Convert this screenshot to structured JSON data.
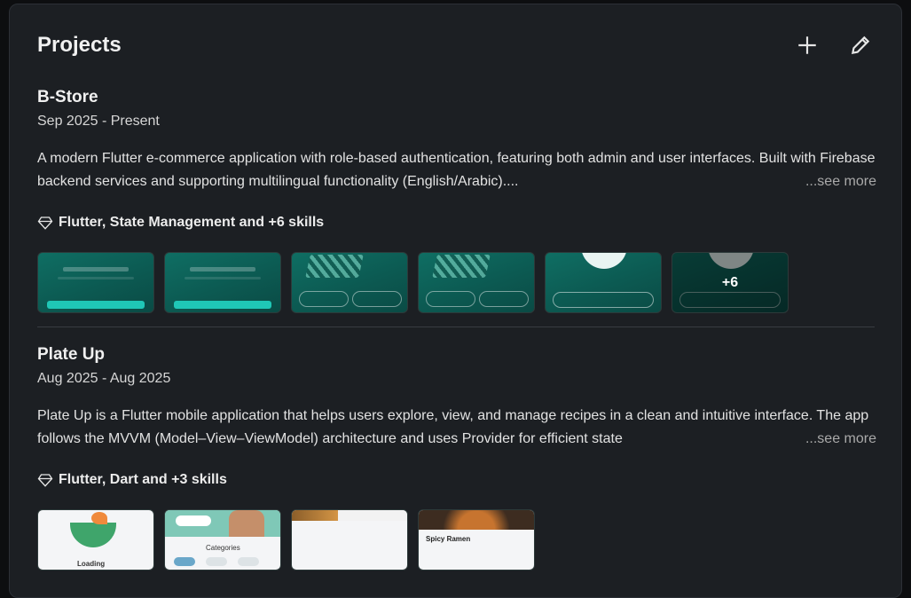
{
  "section": {
    "title": "Projects",
    "actions": {
      "add": "plus-icon",
      "edit": "pencil-icon"
    }
  },
  "projects": [
    {
      "name": "B-Store",
      "date": "Sep 2025 - Present",
      "description": "A modern Flutter e-commerce application with role-based authentication, featuring both admin and user interfaces. Built with Firebase backend services and supporting multilingual functionality (English/Arabic)....",
      "see_more": "...see more",
      "skills": "Flutter, State Management and +6 skills",
      "more_media": "+6"
    },
    {
      "name": "Plate Up",
      "date": "Aug 2025 - Aug 2025",
      "description": "Plate Up is a Flutter mobile application that helps users explore, view, and manage recipes in a clean and intuitive interface. The app follows the MVVM (Model–View–ViewModel) architecture and uses Provider for efficient state",
      "see_more": "...see more",
      "skills": "Flutter, Dart and +3 skills",
      "thumb_labels": [
        "Loading",
        "Categories",
        "Spicy Ramen"
      ]
    }
  ],
  "colors": {
    "card_bg": "#1c1f23",
    "accent_teal": "#0f6e63"
  }
}
